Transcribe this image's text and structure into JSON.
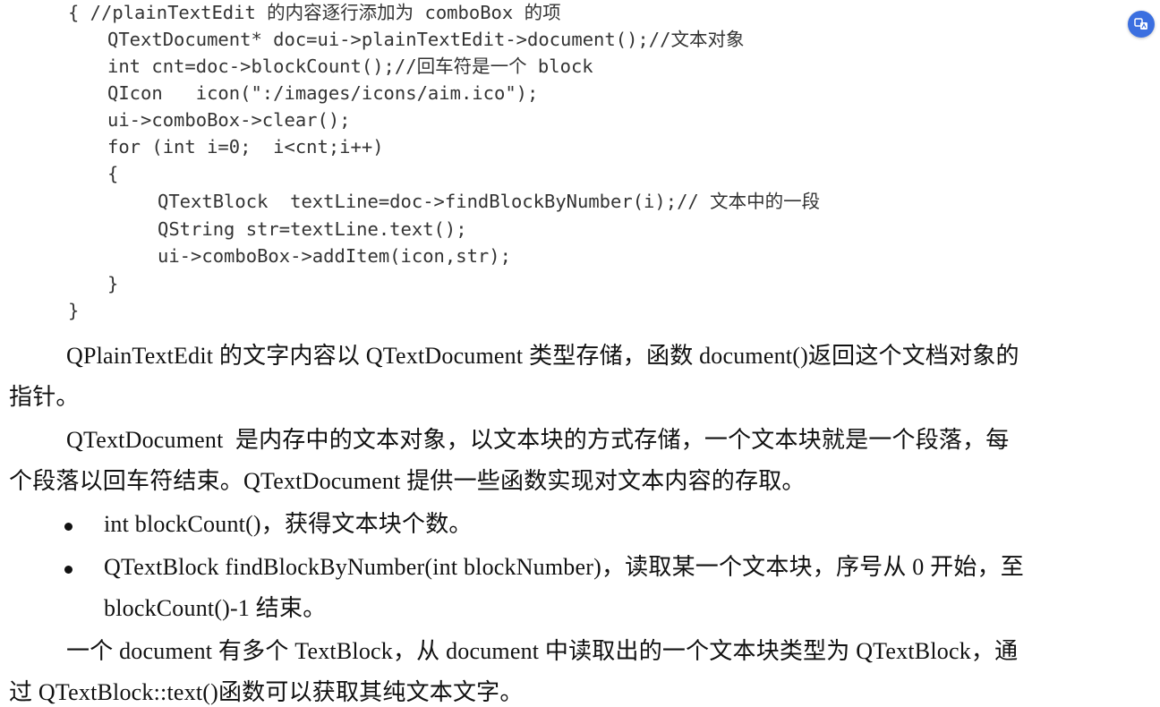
{
  "code": {
    "lines": [
      "{ //plainTextEdit 的内容逐行添加为 comboBox 的项",
      "QTextDocument* doc=ui->plainTextEdit->document();//文本对象",
      "int cnt=doc->blockCount();//回车符是一个 block",
      "QIcon   icon(\":/images/icons/aim.ico\");",
      "ui->comboBox->clear();",
      "for (int i=0;  i<cnt;i++)",
      "{",
      "QTextBlock  textLine=doc->findBlockByNumber(i);// 文本中的一段",
      "QString str=textLine.text();",
      "ui->comboBox->addItem(icon,str);",
      "}",
      "}"
    ]
  },
  "paragraphs": {
    "p1_line1": "QPlainTextEdit 的文字内容以 QTextDocument 类型存储，函数 document()返回这个文档对象的",
    "p1_line2": "指针。",
    "p2_line1": "QTextDocument  是内存中的文本对象，以文本块的方式存储，一个文本块就是一个段落，每",
    "p2_line2": "个段落以回车符结束。QTextDocument 提供一些函数实现对文本内容的存取。",
    "bullet1": "int blockCount()，获得文本块个数。",
    "bullet2_line1": "QTextBlock findBlockByNumber(int blockNumber)，读取某一个文本块，序号从 0 开始，至",
    "bullet2_line2": "blockCount()-1 结束。",
    "p3_line1": "一个 document 有多个 TextBlock，从 document 中读取出的一个文本块类型为 QTextBlock，通",
    "p3_line2": "过 QTextBlock::text()函数可以获取其纯文本文字。"
  },
  "overlay": {
    "icon": "translate-image-icon",
    "color": "#3b6fe0"
  }
}
